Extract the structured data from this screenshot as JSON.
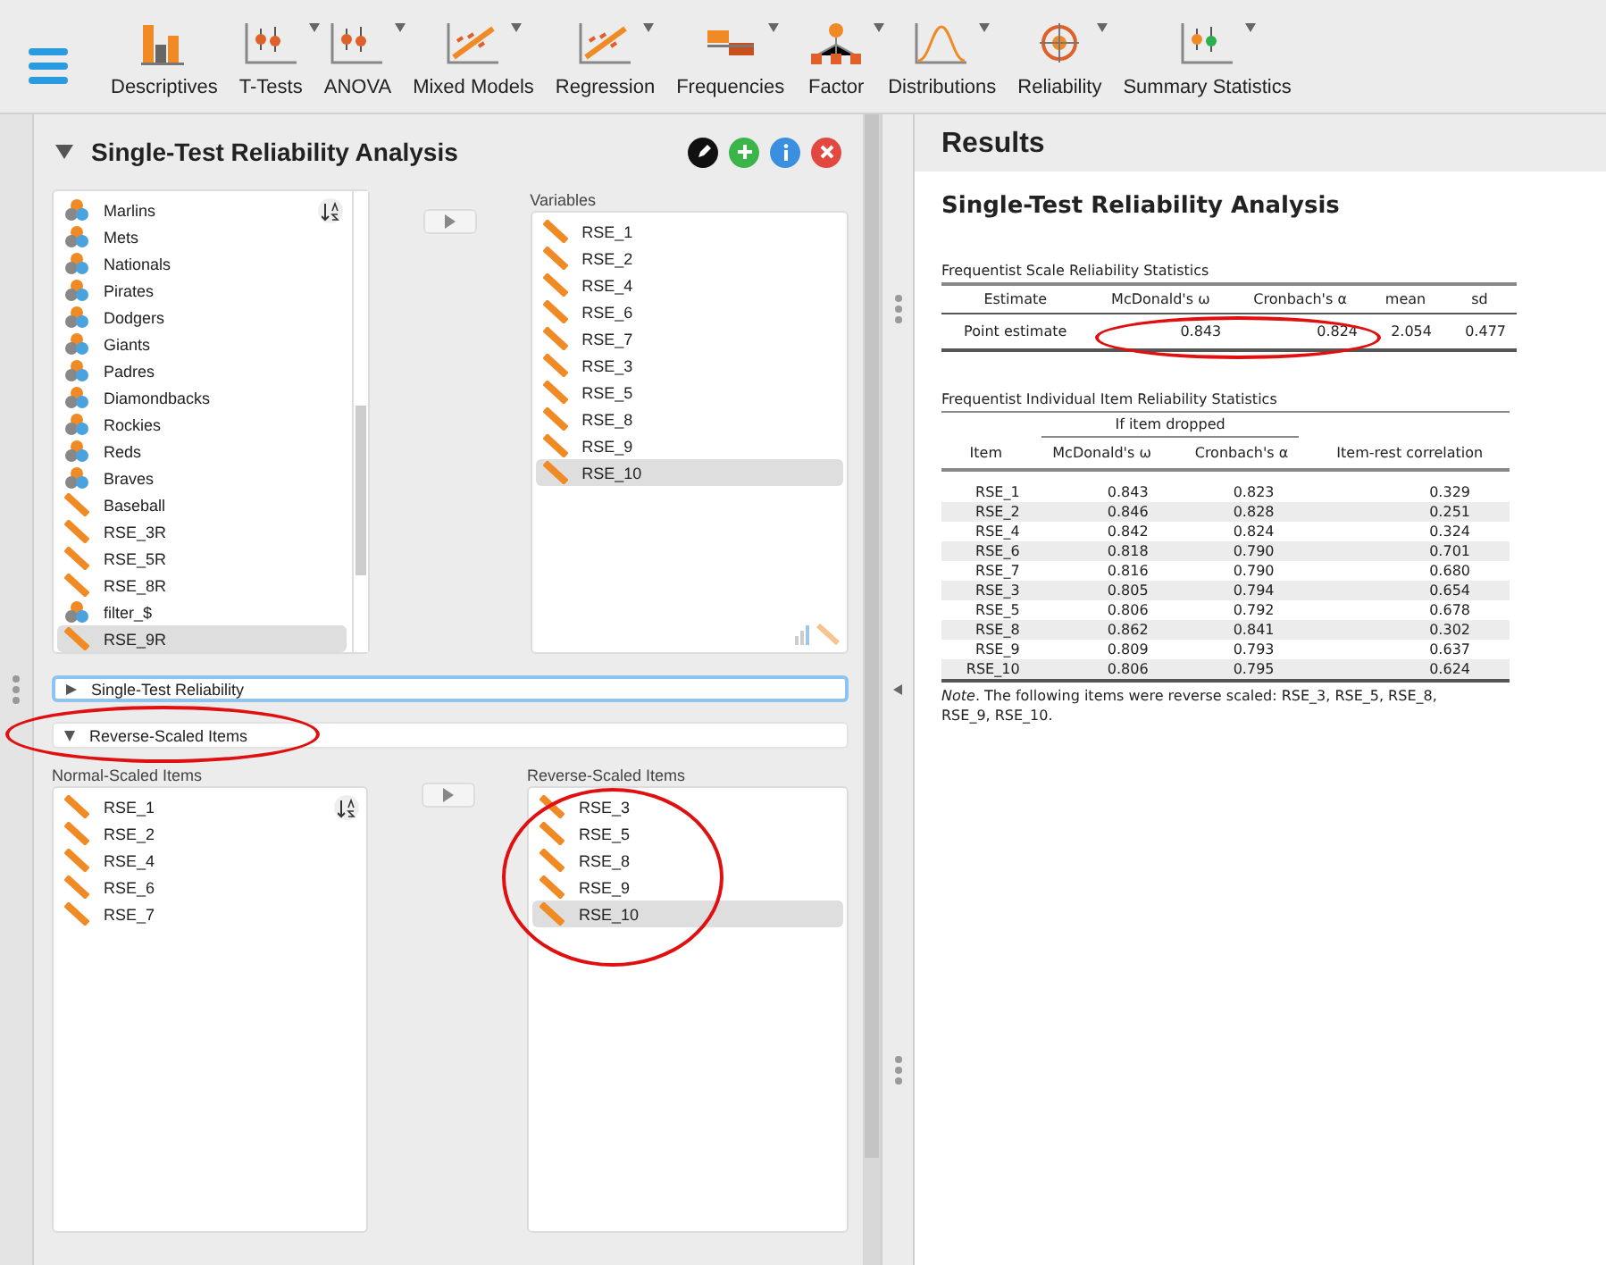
{
  "toolbar": [
    {
      "label": "Descriptives",
      "has_menu": false
    },
    {
      "label": "T-Tests",
      "has_menu": true
    },
    {
      "label": "ANOVA",
      "has_menu": true
    },
    {
      "label": "Mixed Models",
      "has_menu": true
    },
    {
      "label": "Regression",
      "has_menu": true
    },
    {
      "label": "Frequencies",
      "has_menu": true
    },
    {
      "label": "Factor",
      "has_menu": true
    },
    {
      "label": "Distributions",
      "has_menu": true
    },
    {
      "label": "Reliability",
      "has_menu": true
    },
    {
      "label": "Summary Statistics",
      "has_menu": true
    }
  ],
  "analysis": {
    "title": "Single-Test Reliability Analysis",
    "expanded": true,
    "available": [
      {
        "name": "Marlins",
        "kind": "nominal",
        "selected": false
      },
      {
        "name": "Mets",
        "kind": "nominal",
        "selected": false
      },
      {
        "name": "Nationals",
        "kind": "nominal",
        "selected": false
      },
      {
        "name": "Pirates",
        "kind": "nominal",
        "selected": false
      },
      {
        "name": "Dodgers",
        "kind": "nominal",
        "selected": false
      },
      {
        "name": "Giants",
        "kind": "nominal",
        "selected": false
      },
      {
        "name": "Padres",
        "kind": "nominal",
        "selected": false
      },
      {
        "name": "Diamondbacks",
        "kind": "nominal",
        "selected": false
      },
      {
        "name": "Rockies",
        "kind": "nominal",
        "selected": false
      },
      {
        "name": "Reds",
        "kind": "nominal",
        "selected": false
      },
      {
        "name": "Braves",
        "kind": "nominal",
        "selected": false
      },
      {
        "name": "Baseball",
        "kind": "scale",
        "selected": false
      },
      {
        "name": "RSE_3R",
        "kind": "scale",
        "selected": false
      },
      {
        "name": "RSE_5R",
        "kind": "scale",
        "selected": false
      },
      {
        "name": "RSE_8R",
        "kind": "scale",
        "selected": false
      },
      {
        "name": "filter_$",
        "kind": "nominal",
        "selected": false
      },
      {
        "name": "RSE_9R",
        "kind": "scale",
        "selected": true
      }
    ],
    "variables_label": "Variables",
    "variables": [
      {
        "name": "RSE_1",
        "kind": "scale",
        "selected": false
      },
      {
        "name": "RSE_2",
        "kind": "scale",
        "selected": false
      },
      {
        "name": "RSE_4",
        "kind": "scale",
        "selected": false
      },
      {
        "name": "RSE_6",
        "kind": "scale",
        "selected": false
      },
      {
        "name": "RSE_7",
        "kind": "scale",
        "selected": false
      },
      {
        "name": "RSE_3",
        "kind": "scale",
        "selected": false
      },
      {
        "name": "RSE_5",
        "kind": "scale",
        "selected": false
      },
      {
        "name": "RSE_8",
        "kind": "scale",
        "selected": false
      },
      {
        "name": "RSE_9",
        "kind": "scale",
        "selected": false
      },
      {
        "name": "RSE_10",
        "kind": "scale",
        "selected": true
      }
    ],
    "sections": [
      {
        "title": "Single-Test Reliability",
        "expanded": false,
        "focused": true,
        "highlighted": false
      },
      {
        "title": "Reverse-Scaled Items",
        "expanded": true,
        "focused": false,
        "highlighted": true
      }
    ],
    "normal_label": "Normal-Scaled Items",
    "normal": [
      {
        "name": "RSE_1",
        "kind": "scale",
        "selected": false
      },
      {
        "name": "RSE_2",
        "kind": "scale",
        "selected": false
      },
      {
        "name": "RSE_4",
        "kind": "scale",
        "selected": false
      },
      {
        "name": "RSE_6",
        "kind": "scale",
        "selected": false
      },
      {
        "name": "RSE_7",
        "kind": "scale",
        "selected": false
      }
    ],
    "reverse_label": "Reverse-Scaled Items",
    "reverse_highlighted": true,
    "reverse": [
      {
        "name": "RSE_3",
        "kind": "scale",
        "selected": false
      },
      {
        "name": "RSE_5",
        "kind": "scale",
        "selected": false
      },
      {
        "name": "RSE_8",
        "kind": "scale",
        "selected": false
      },
      {
        "name": "RSE_9",
        "kind": "scale",
        "selected": false
      },
      {
        "name": "RSE_10",
        "kind": "scale",
        "selected": true
      }
    ]
  },
  "results": {
    "header": "Results",
    "title": "Single-Test Reliability Analysis",
    "scale_table": {
      "title": "Frequentist Scale Reliability Statistics",
      "highlighted": true,
      "columns": [
        "Estimate",
        "McDonald's ω",
        "Cronbach's α",
        "mean",
        "sd"
      ],
      "rows": [
        [
          "Point estimate",
          "0.843",
          "0.824",
          "2.054",
          "0.477"
        ]
      ]
    },
    "item_table": {
      "title": "Frequentist Individual Item Reliability Statistics",
      "group": "If item dropped",
      "columns": [
        "Item",
        "McDonald's ω",
        "Cronbach's α",
        "Item-rest correlation"
      ],
      "rows": [
        [
          "RSE_1",
          "0.843",
          "0.823",
          "0.329"
        ],
        [
          "RSE_2",
          "0.846",
          "0.828",
          "0.251"
        ],
        [
          "RSE_4",
          "0.842",
          "0.824",
          "0.324"
        ],
        [
          "RSE_6",
          "0.818",
          "0.790",
          "0.701"
        ],
        [
          "RSE_7",
          "0.816",
          "0.790",
          "0.680"
        ],
        [
          "RSE_3",
          "0.805",
          "0.794",
          "0.654"
        ],
        [
          "RSE_5",
          "0.806",
          "0.792",
          "0.678"
        ],
        [
          "RSE_8",
          "0.862",
          "0.841",
          "0.302"
        ],
        [
          "RSE_9",
          "0.809",
          "0.793",
          "0.637"
        ],
        [
          "RSE_10",
          "0.806",
          "0.795",
          "0.624"
        ]
      ],
      "note": "*Note*. The following items were reverse scaled: RSE_3, RSE_5, RSE_8, RSE_9, RSE_10."
    }
  }
}
